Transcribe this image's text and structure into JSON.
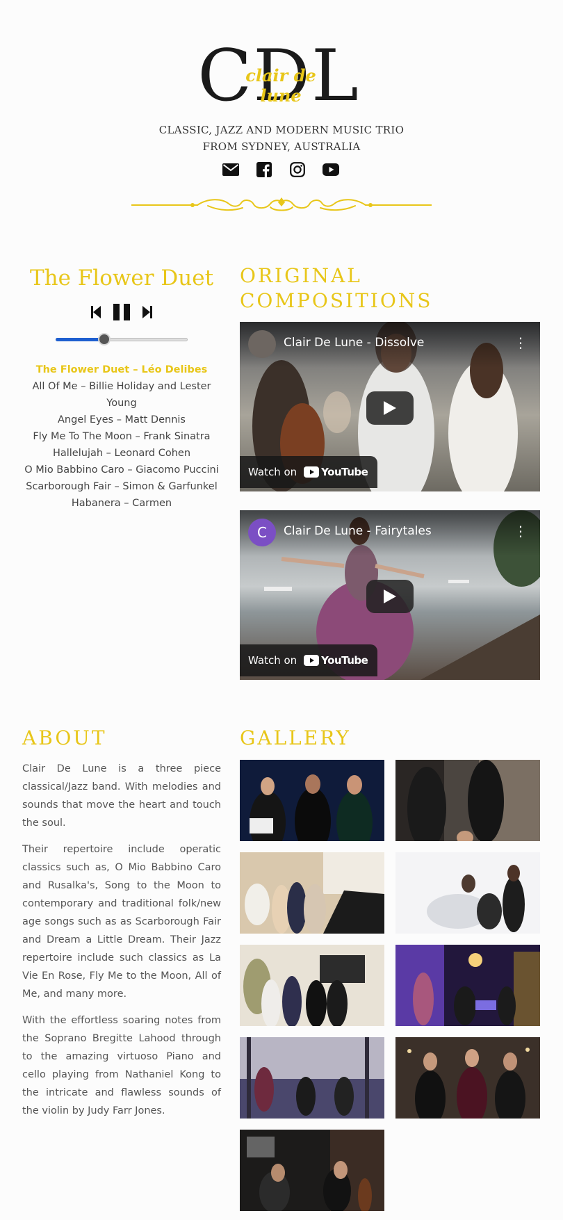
{
  "brand": {
    "monogram": "CDL",
    "script": "clair de lune",
    "tagline_line1": "CLASSIC, JAZZ AND MODERN MUSIC TRIO",
    "tagline_line2": "FROM SYDNEY, AUSTRALIA"
  },
  "social": [
    {
      "icon": "email-icon"
    },
    {
      "icon": "facebook-icon"
    },
    {
      "icon": "instagram-icon"
    },
    {
      "icon": "youtube-icon"
    }
  ],
  "player": {
    "title": "The Flower Duet",
    "progress_fraction": 0.37,
    "playlist": [
      "The Flower Duet – Léo Delibes",
      "All Of Me – Billie Holiday and Lester Young",
      "Angel Eyes – Matt Dennis",
      "Fly Me To The Moon – Frank Sinatra",
      "Hallelujah – Leonard Cohen",
      "O Mio Babbino Caro – Giacomo Puccini",
      "Scarborough Fair – Simon & Garfunkel",
      "Habanera – Carmen"
    ],
    "active_index": 0
  },
  "compositions": {
    "title_line1": "ORIGINAL",
    "title_line2": "COMPOSITIONS",
    "videos": [
      {
        "title": "Clair De Lune - Dissolve",
        "avatar_letter": "",
        "watch_label": "Watch on",
        "platform": "YouTube"
      },
      {
        "title": "Clair De Lune - Fairytales",
        "avatar_letter": "C",
        "watch_label": "Watch on",
        "platform": "YouTube"
      }
    ]
  },
  "about": {
    "title": "ABOUT",
    "paragraphs": [
      "Clair De Lune is a three piece classical/Jazz band. With melodies and sounds that move the heart and touch the soul.",
      "Their repertoire include operatic classics such as, O Mio Babbino Caro and Rusalka's, Song to the Moon to contemporary and traditional folk/new age songs such as as Scarborough Fair and Dream a Little Dream. Their Jazz repertoire include such classics as La Vie En Rose, Fly Me to the Moon, All of Me, and many more.",
      "With the effortless soaring notes from the Soprano Bregitte Lahood through to the amazing virtuoso Piano and cello playing from Nathaniel Kong to the intricate and flawless sounds of the violin by Judy Farr Jones."
    ]
  },
  "gallery": {
    "title": "GALLERY"
  },
  "colors": {
    "accent": "#e8c619",
    "text": "#444444",
    "progress": "#1e5fd0",
    "background": "#fcfcfc"
  }
}
